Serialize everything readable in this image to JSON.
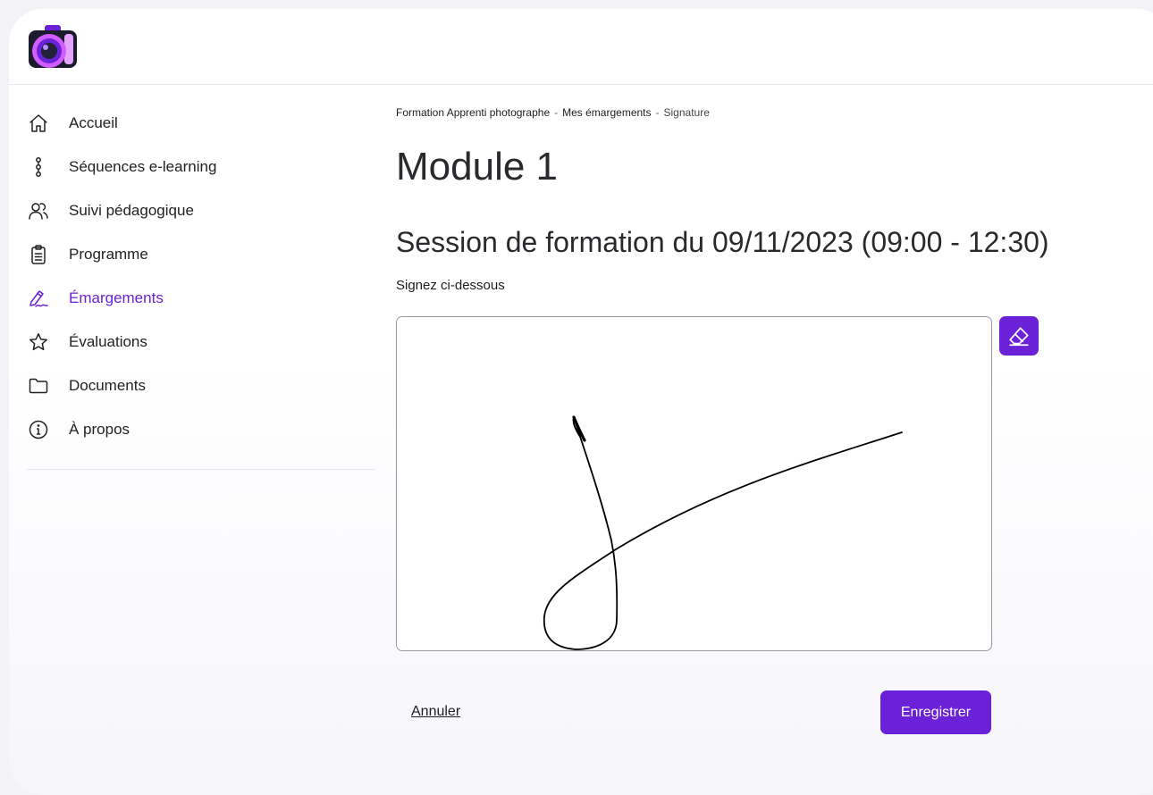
{
  "brand": {
    "logo_icon": "camera-logo-icon"
  },
  "sidebar": {
    "items": [
      {
        "label": "Accueil",
        "icon": "home-icon",
        "active": false
      },
      {
        "label": "Séquences e-learning",
        "icon": "sequence-icon",
        "active": false
      },
      {
        "label": "Suivi pédagogique",
        "icon": "users-icon",
        "active": false
      },
      {
        "label": "Programme",
        "icon": "clipboard-icon",
        "active": false
      },
      {
        "label": "Émargements",
        "icon": "signature-pen-icon",
        "active": true
      },
      {
        "label": "Évaluations",
        "icon": "star-icon",
        "active": false
      },
      {
        "label": "Documents",
        "icon": "folder-icon",
        "active": false
      },
      {
        "label": "À propos",
        "icon": "info-icon",
        "active": false
      }
    ]
  },
  "breadcrumb": {
    "items": [
      "Formation Apprenti photographe",
      "Mes émargements",
      "Signature"
    ],
    "separator": "-"
  },
  "main": {
    "title": "Module 1",
    "session_title": "Session de formation du 09/11/2023 (09:00 - 12:30)",
    "sign_label": "Signez ci-dessous",
    "erase_icon": "eraser-icon"
  },
  "actions": {
    "cancel_label": "Annuler",
    "save_label": "Enregistrer"
  },
  "colors": {
    "accent": "#6b21d8",
    "text": "#1d1d1f",
    "background": "#f3f2f7"
  }
}
